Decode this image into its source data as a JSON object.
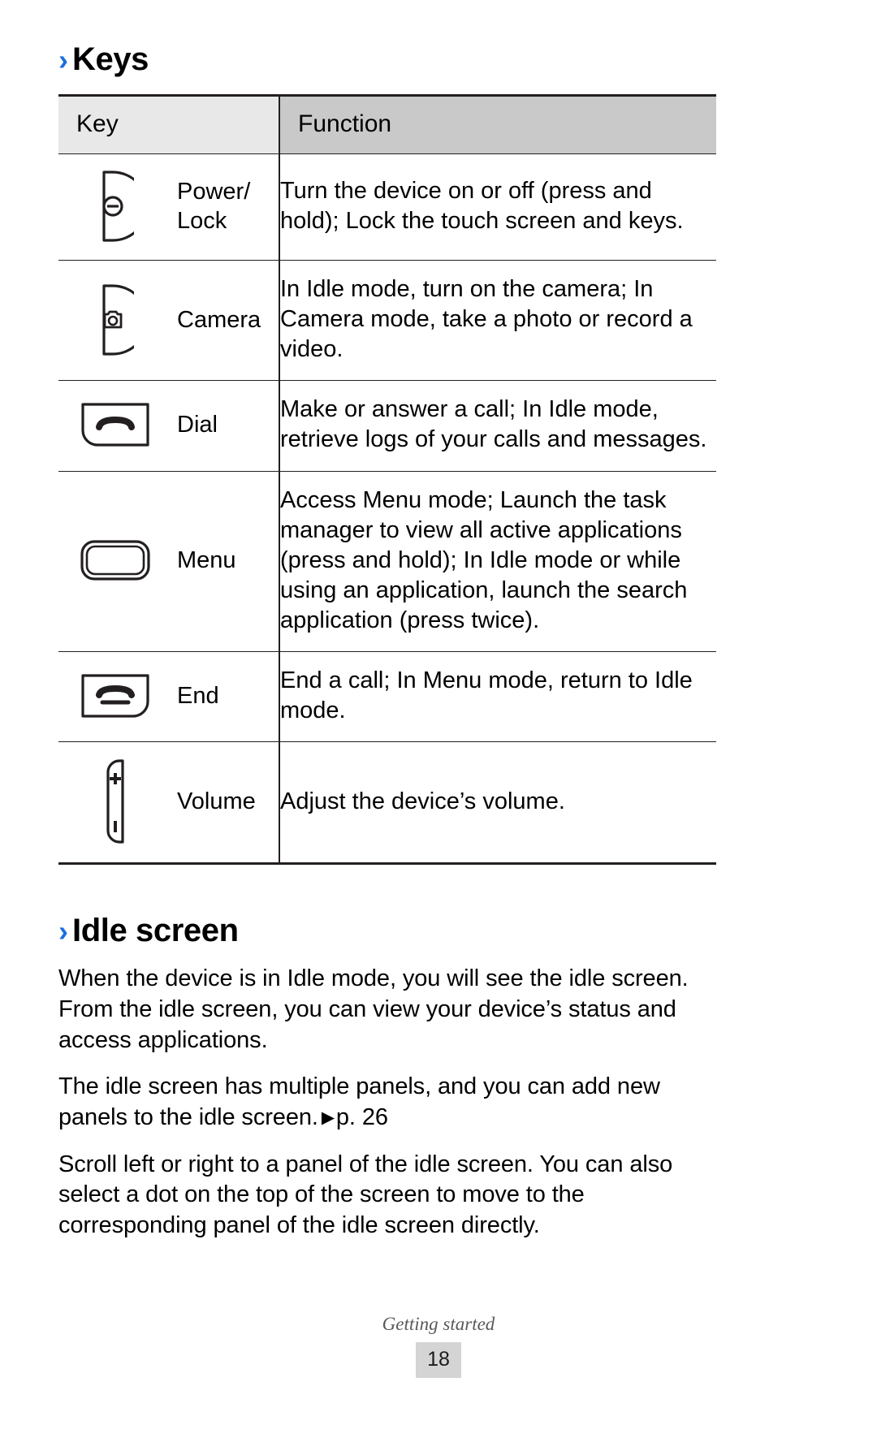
{
  "document": {
    "page_number": "18",
    "footer_title": "Getting started"
  },
  "sections": {
    "keys": {
      "chevron": "›",
      "title": "Keys"
    },
    "idle": {
      "chevron": "›",
      "title": "Idle screen"
    }
  },
  "table": {
    "headers": {
      "key": "Key",
      "function": "Function"
    },
    "rows": [
      {
        "icon": "power-lock-key-icon",
        "label_line1": "Power/",
        "label_line2": "Lock",
        "function": "Turn the device on or off (press and hold); Lock the touch screen and keys."
      },
      {
        "icon": "camera-key-icon",
        "label_line1": "Camera",
        "label_line2": "",
        "function": "In Idle mode, turn on the camera; In Camera mode, take a photo or record a video."
      },
      {
        "icon": "dial-key-icon",
        "label_line1": "Dial",
        "label_line2": "",
        "function": "Make or answer a call; In Idle mode, retrieve logs of your calls and messages."
      },
      {
        "icon": "menu-key-icon",
        "label_line1": "Menu",
        "label_line2": "",
        "function": "Access Menu mode; Launch the task manager to view all active applications (press and hold); In Idle mode or while using an application, launch the search application (press twice)."
      },
      {
        "icon": "end-key-icon",
        "label_line1": "End",
        "label_line2": "",
        "function": "End a call; In Menu mode, return to Idle mode."
      },
      {
        "icon": "volume-key-icon",
        "label_line1": "Volume",
        "label_line2": "",
        "function": "Adjust the device’s volume."
      }
    ]
  },
  "idle_paragraphs": {
    "p1": "When the device is in Idle mode, you will see the idle screen. From the idle screen, you can view your device’s status and access applications.",
    "p2_before": "The idle screen has multiple panels, and you can add new panels to the idle screen.",
    "p2_arrow": "▶",
    "p2_ref": "p. 26",
    "p3": "Scroll left or right to a panel of the idle screen. You can also select a dot on the top of the screen to move to the corresponding panel of the idle screen directly."
  },
  "colors": {
    "chevron_blue": "#1a6fe0",
    "header_key_bg": "#e8e8e8",
    "header_function_bg": "#c9c9c9",
    "rule": "#231f20",
    "page_badge_bg": "#d4d4d4",
    "footer_text": "#58595b"
  }
}
